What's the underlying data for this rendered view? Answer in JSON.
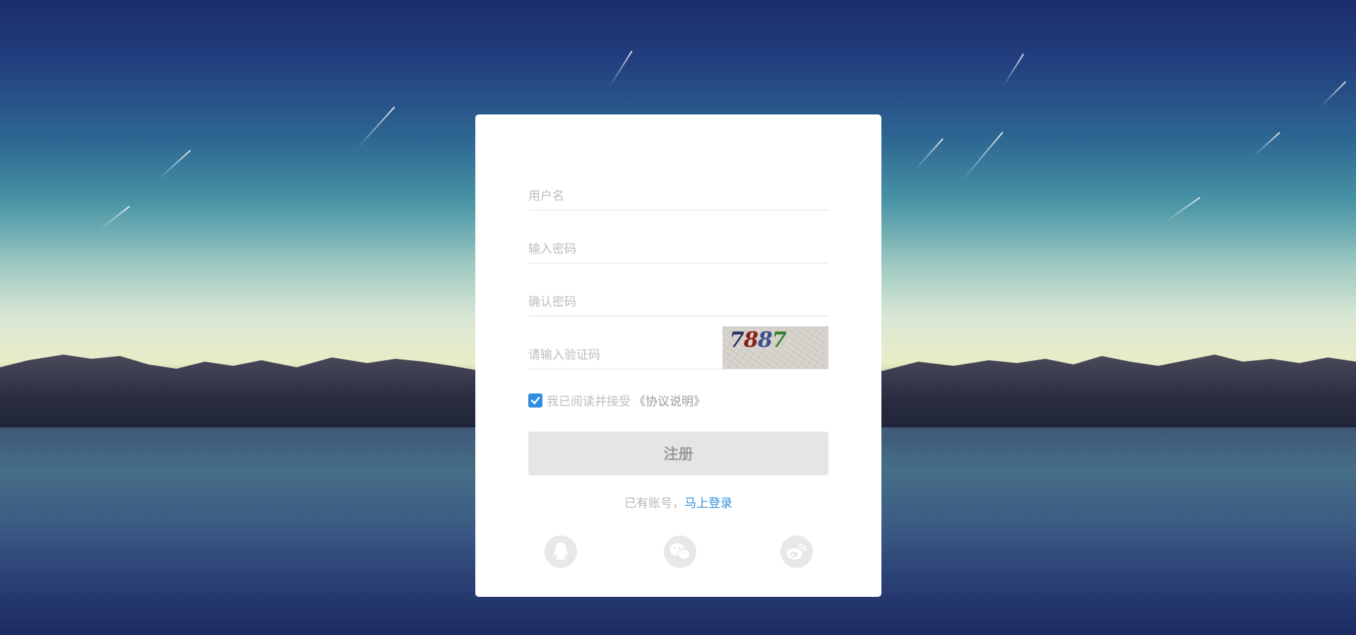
{
  "form": {
    "username_placeholder": "用户名",
    "password_placeholder": "输入密码",
    "confirm_password_placeholder": "确认密码",
    "captcha_placeholder": "请输入验证码",
    "captcha_digits": [
      "7",
      "8",
      "8",
      "7"
    ],
    "agree_text": "我已阅读并接受",
    "agreement_link": "《协议说明》",
    "agree_checked": true,
    "register_label": "注册",
    "have_account_text": "已有账号，",
    "login_link": "马上登录"
  },
  "social": [
    "qq-icon",
    "wechat-icon",
    "weibo-icon"
  ],
  "colors": {
    "accent": "#2f8fde",
    "button_bg": "#e5e5e5",
    "captcha_digit_colors": [
      "#2b2f66",
      "#8b1d1d",
      "#3a4f8f",
      "#2e7d32"
    ]
  }
}
